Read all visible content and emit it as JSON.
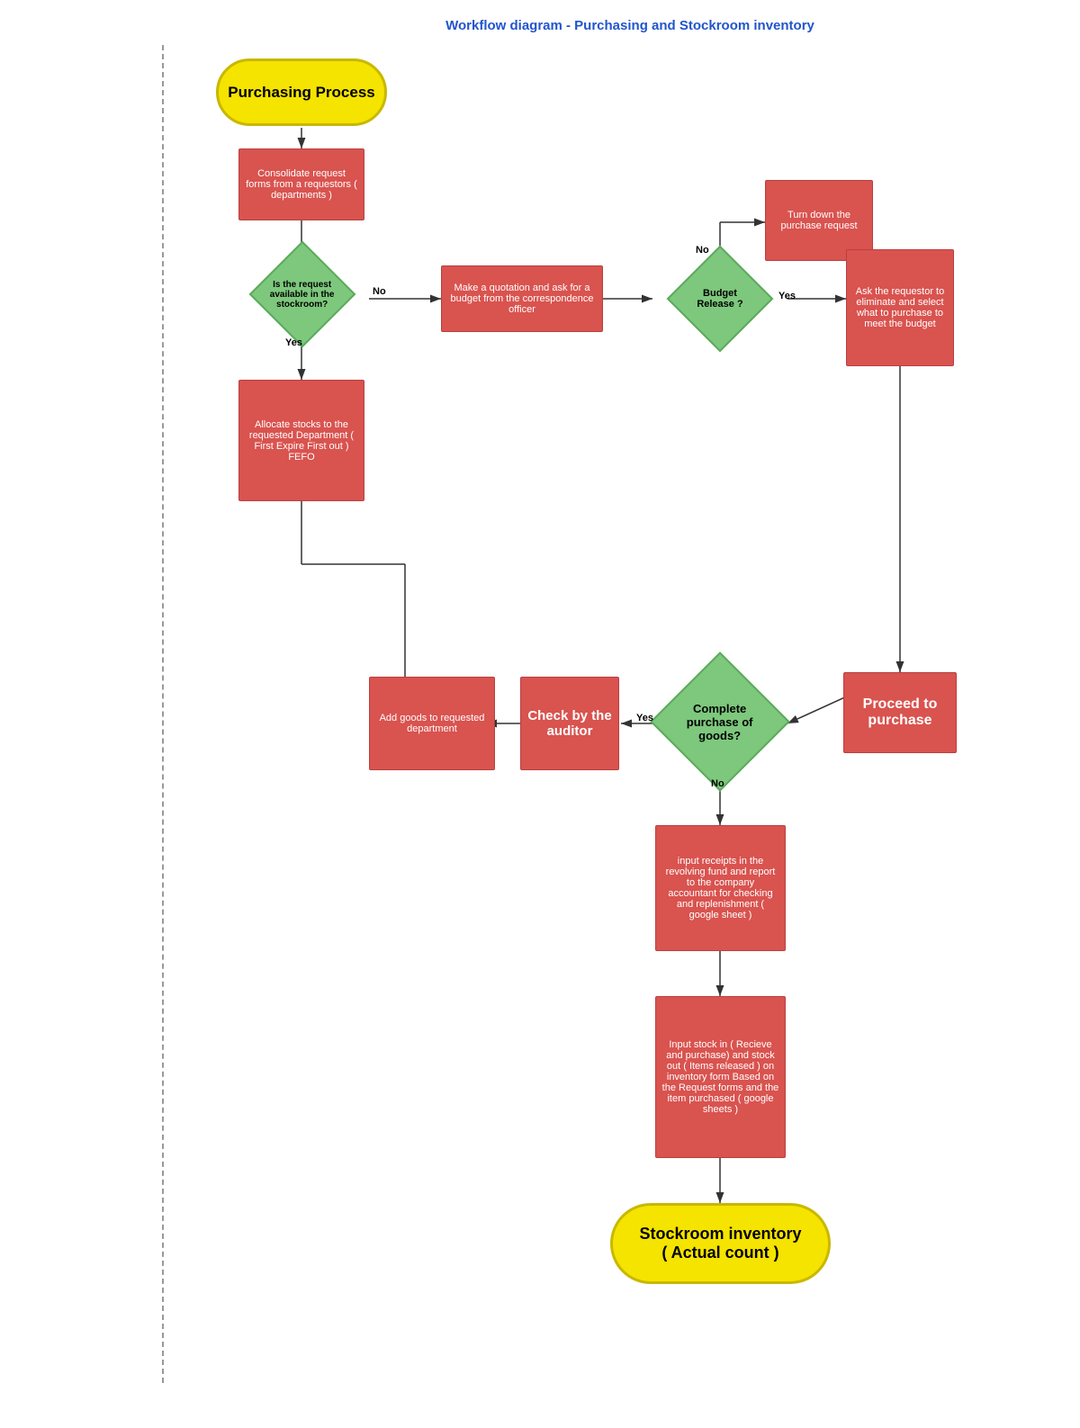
{
  "title": "Workflow diagram - Purchasing and Stockroom inventory",
  "start_label": "Purchasing Process",
  "end_label": "Stockroom inventory\n( Actual count )",
  "nodes": {
    "consolidate": "Consolidate request forms from a requestors ( departments )",
    "is_available": "Is the request available in the stockroom?",
    "allocate": "Allocate stocks to the requested Department\n\n( First Expire First out )\nFEFO",
    "make_quotation": "Make a quotation and ask for a budget from the correspondence officer",
    "budget_release": "Budget Release ?",
    "turn_down": "Turn down the purchase request",
    "ask_requestor": "Ask the requestor to eliminate and select what to purchase to meet the budget",
    "proceed": "Proceed to purchase",
    "complete_purchase": "Complete purchase of goods?",
    "check_auditor": "Check by the auditor",
    "add_goods": "Add goods to requested department",
    "input_receipts": "input receipts in the revolving fund and report to the company accountant for checking and replenishment ( google sheet )",
    "input_stock": "Input stock in ( Recieve and purchase) and stock out ( Items released ) on inventory form Based on the Request forms and the item purchased ( google sheets )"
  },
  "labels": {
    "no": "No",
    "yes": "Yes",
    "no2": "No",
    "yes2": "Yes",
    "no3": "No",
    "yes3": "Yes"
  },
  "colors": {
    "yellow": "#f5e300",
    "red": "#d9534f",
    "green": "#7dc87d",
    "blue_title": "#2255cc"
  }
}
